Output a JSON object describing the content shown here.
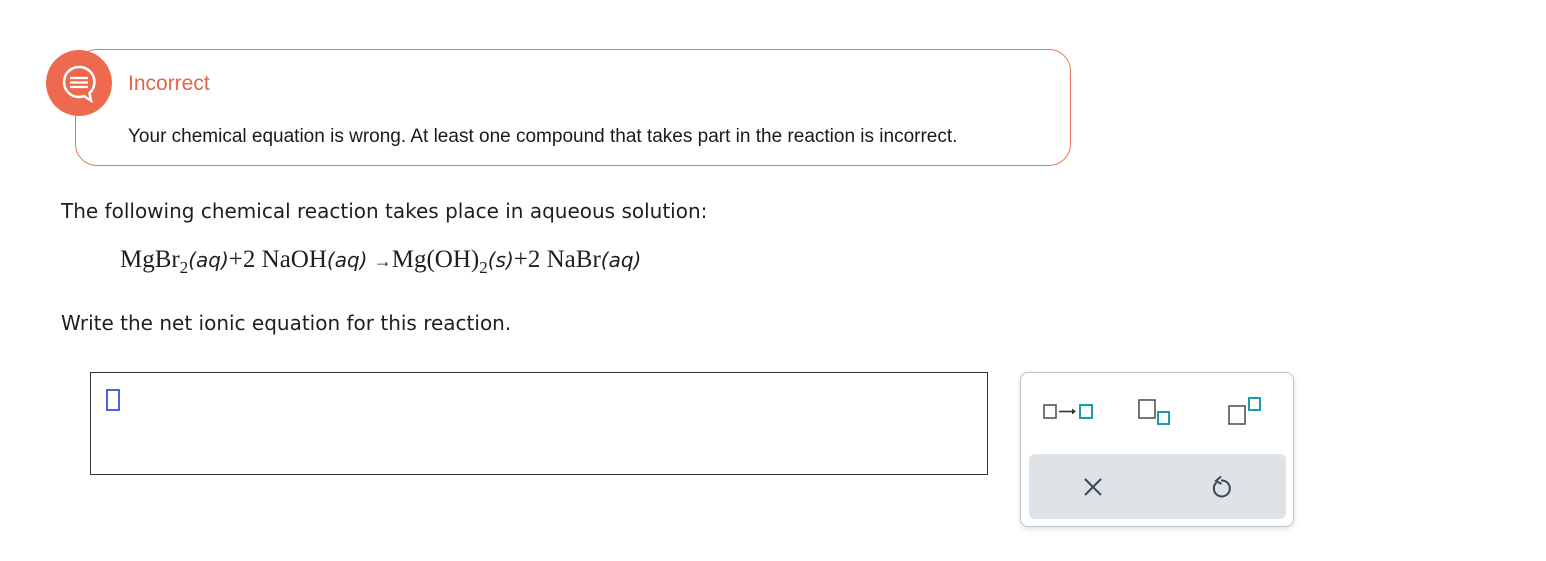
{
  "feedback": {
    "title": "Incorrect",
    "message": "Your chemical equation is wrong. At least one compound that takes part in the reaction is incorrect.",
    "icon": "chat-bubble-icon",
    "accent_color": "#ee6a4f"
  },
  "question": {
    "prompt": "The following chemical reaction takes place in aqueous solution:",
    "equation": {
      "r1": "MgBr",
      "r1_sub": "2",
      "r1_state": "(aq)",
      "plus1": "+",
      "r2_coef": "2",
      "r2": "NaOH",
      "r2_state": "(aq)",
      "arrow": "→",
      "p1": "Mg",
      "p1_group": "(OH)",
      "p1_sub": "2",
      "p1_state": "(s)",
      "plus2": "+",
      "p2_coef": "2",
      "p2": "NaBr",
      "p2_state": "(aq)"
    },
    "instruction": "Write the net ionic equation for this reaction."
  },
  "answer": {
    "value": ""
  },
  "palette": {
    "buttons": [
      "reaction-arrow-icon",
      "subscript-icon",
      "superscript-icon"
    ],
    "clear": "close-icon",
    "undo": "undo-icon",
    "accent_color": "#1a9bb0"
  }
}
